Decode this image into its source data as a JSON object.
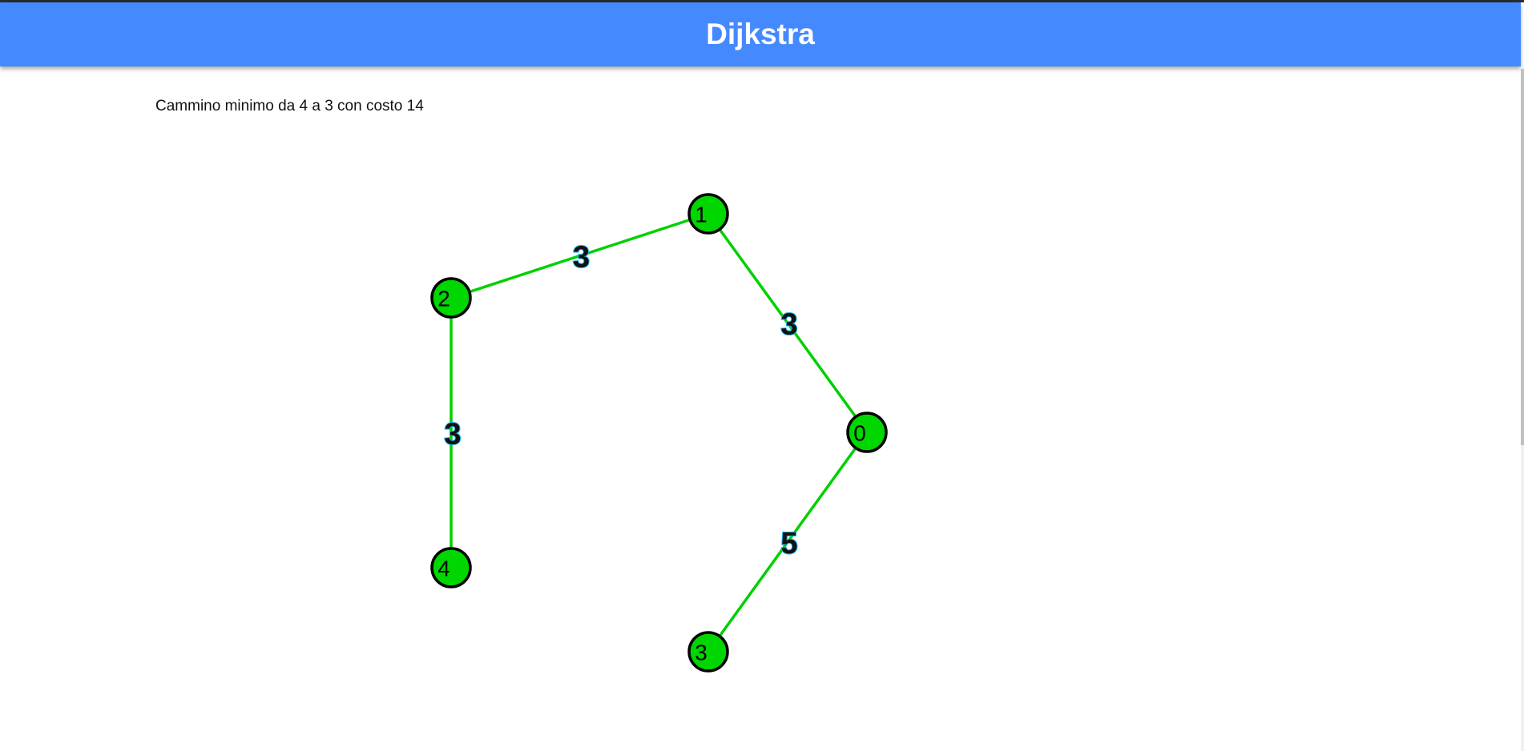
{
  "header": {
    "title": "Dijkstra"
  },
  "result": {
    "text": "Cammino minimo da 4 a 3 con costo 14"
  },
  "colors": {
    "header_bg": "#4589ff",
    "node_fill": "#00d600",
    "edge": "#00d000",
    "weight_text": "#111111",
    "weight_outline": "#19b2ea"
  },
  "graph": {
    "nodes": [
      {
        "id": "0",
        "label": "0"
      },
      {
        "id": "1",
        "label": "1"
      },
      {
        "id": "2",
        "label": "2"
      },
      {
        "id": "3",
        "label": "3"
      },
      {
        "id": "4",
        "label": "4"
      }
    ],
    "edges": [
      {
        "from": "2",
        "to": "1",
        "weight": "3"
      },
      {
        "from": "1",
        "to": "0",
        "weight": "3"
      },
      {
        "from": "2",
        "to": "4",
        "weight": "3"
      },
      {
        "from": "0",
        "to": "3",
        "weight": "5"
      }
    ]
  }
}
